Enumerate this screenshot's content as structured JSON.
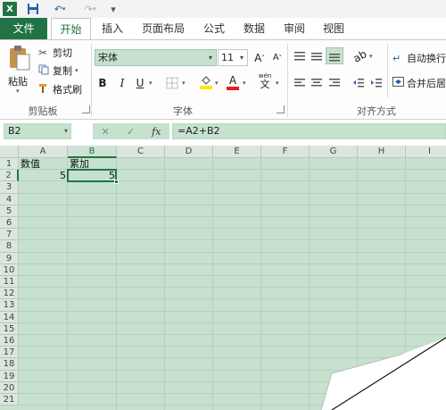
{
  "app": {
    "icon_label": "X"
  },
  "ribbon_tabs": [
    "文件",
    "开始",
    "插入",
    "页面布局",
    "公式",
    "数据",
    "审阅",
    "视图"
  ],
  "clipboard": {
    "paste": "粘贴",
    "cut": "剪切",
    "copy": "复制",
    "format_painter": "格式刷",
    "group_label": "剪贴板"
  },
  "font": {
    "name": "宋体",
    "size": "11",
    "grow": "A",
    "shrink": "A",
    "bold": "B",
    "italic": "I",
    "underline": "U",
    "font_color_letter": "A",
    "fill_color": "#ffe500",
    "font_color": "#e02020",
    "pinyin": "wén",
    "group_label": "字体"
  },
  "alignment": {
    "wrap_text": "自动换行",
    "merge_center": "合并后居",
    "group_label": "对齐方式"
  },
  "formula_bar": {
    "name_box": "B2",
    "cancel": "✕",
    "enter": "✓",
    "fx": "fx",
    "formula": "=A2+B2"
  },
  "sheet": {
    "columns": [
      "A",
      "B",
      "C",
      "D",
      "E",
      "F",
      "G",
      "H",
      "I"
    ],
    "rows": [
      "1",
      "2",
      "3",
      "4",
      "5",
      "6",
      "7",
      "8",
      "9",
      "10",
      "11",
      "12",
      "13",
      "14",
      "15",
      "16",
      "17",
      "18",
      "19",
      "20",
      "21"
    ],
    "cells": {
      "A1": "数值",
      "B1": "累加",
      "A2": "5",
      "B2": "5"
    },
    "active_cell": "B2"
  }
}
